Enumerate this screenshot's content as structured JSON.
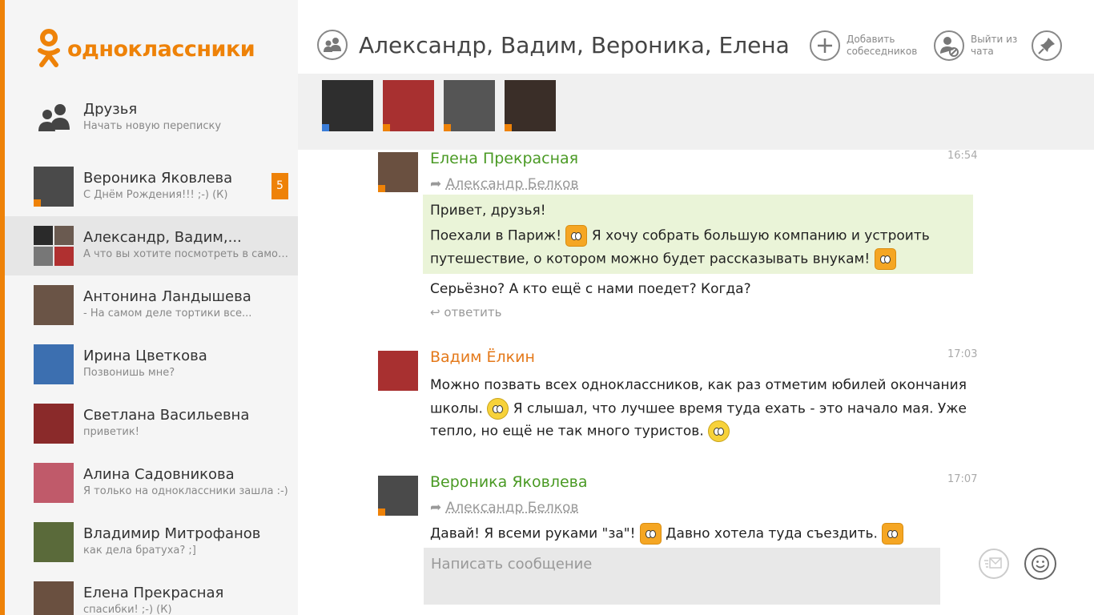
{
  "app": {
    "logo_text": "одноклассники",
    "accent_color": "#ee8208"
  },
  "sidebar": {
    "friends": {
      "title": "Друзья",
      "subtitle": "Начать новую переписку"
    },
    "conversations": [
      {
        "name": "Вероника Яковлева",
        "preview": "С Днём Рождения!!! ;-) (К)",
        "badge": "5",
        "avatar_color": "#4a4a4a"
      },
      {
        "name": "Александр, Вадим,...",
        "preview": "А что вы хотите посмотреть в самом...",
        "active": true,
        "avatar_colors": [
          "#2a2a2a",
          "#6a5a50",
          "#777",
          "#b03030"
        ]
      },
      {
        "name": "Антонина Ландышева",
        "preview": "- На самом деле тортики все...",
        "avatar_color": "#6a5446"
      },
      {
        "name": "Ирина Цветкова",
        "preview": "Позвонишь мне?",
        "avatar_color": "#3c6fb0"
      },
      {
        "name": "Светлана Васильевна",
        "preview": "приветик!",
        "avatar_color": "#8a2a2a"
      },
      {
        "name": "Алина Садовникова",
        "preview": "Я только на одноклассники зашла :-)",
        "avatar_color": "#c05a6a"
      },
      {
        "name": "Владимир Митрофанов",
        "preview": "как дела братуха? ;]",
        "avatar_color": "#5a6a3a"
      },
      {
        "name": "Елена Прекрасная",
        "preview": "спасибки! ;-) (К)",
        "avatar_color": "#6a5040"
      }
    ]
  },
  "header": {
    "title": "Александр, Вадим, Вероника, Елена",
    "add_label": "Добавить собеседников",
    "leave_label": "Выйти из чата"
  },
  "participants": [
    {
      "color": "#2e2e2e",
      "status": "#3b7dd8"
    },
    {
      "color": "#a83030",
      "status": "#ee8208"
    },
    {
      "color": "#555555",
      "status": "#ee8208"
    },
    {
      "color": "#3a2e28",
      "status": "#ee8208"
    }
  ],
  "messages": {
    "m1": {
      "author": "Елена Прекрасная",
      "time": "16:54",
      "forwarded_from": "Александр Белков",
      "line1": "Привет, друзья!",
      "line2a": "Поехали в Париж!",
      "line2b": "Я хочу собрать большую компанию и устроить",
      "line3": "путешествие, о котором можно будет рассказывать внукам!",
      "line4": "Серьёзно? А кто ещё с нами поедет? Когда?",
      "reply": "ответить"
    },
    "m2": {
      "author": "Вадим Ёлкин",
      "time": "17:03",
      "line1": "Можно позвать всех одноклассников, как раз отметим юбилей окончания",
      "line2a": "школы.",
      "line2b": "Я слышал, что лучшее время туда ехать - это начало мая. Уже",
      "line3": "тепло, но ещё не так много туристов."
    },
    "m3": {
      "author": "Вероника Яковлева",
      "time": "17:07",
      "forwarded_from": "Александр Белков",
      "line1a": "Давай! Я всеми руками \"за\"!",
      "line1b": "Давно хотела туда съездить."
    }
  },
  "composer": {
    "placeholder": "Написать сообщение"
  }
}
